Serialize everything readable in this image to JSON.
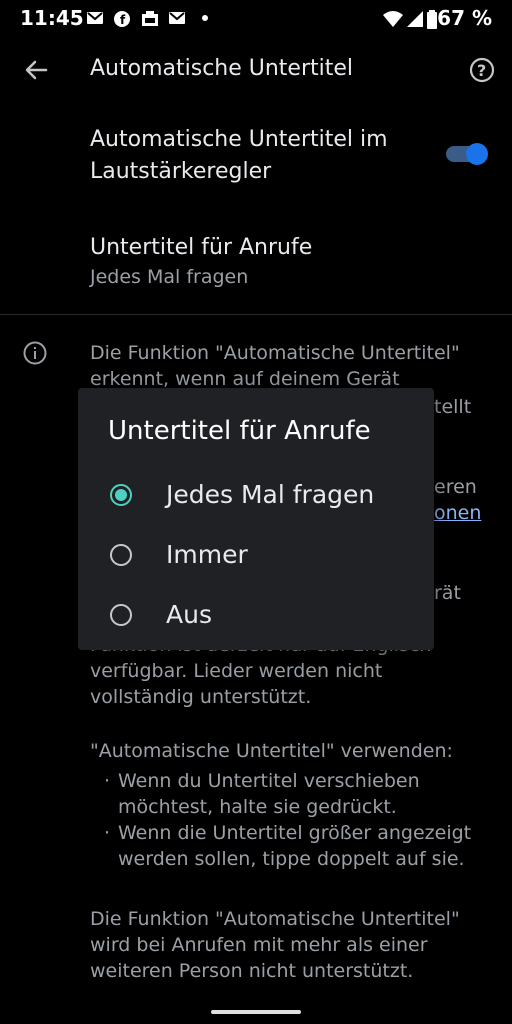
{
  "status_bar": {
    "time": "11:45",
    "icons": [
      "gmail-icon",
      "facebook-icon",
      "app-icon",
      "mail-icon",
      "dot-icon"
    ],
    "battery_percent": "67 %"
  },
  "app_bar": {
    "title": "Automatische Untertitel",
    "back_icon": "arrow-back-icon",
    "help_icon": "help-icon"
  },
  "settings": {
    "item1": {
      "title_line1": "Automatische Untertitel im",
      "title_line2": "Lautstärkeregler",
      "toggle_on": true
    },
    "item2": {
      "title": "Untertitel für Anrufe",
      "subtitle": "Jedes Mal fragen"
    }
  },
  "info": {
    "p1_line1": "Die Funktion \"Automatische Untertitel\"",
    "p1_line2": "erkennt, wenn auf deinem Gerät",
    "p1_line3_fragment": "tellt",
    "p1_line5_fragment": "eren",
    "p1_link_fragment": "onen",
    "p1_line7_fragment": "rät",
    "p2_line1": "Funktion ist derzeit nur auf Englisch",
    "p2_line2": "verfügbar. Lieder werden nicht",
    "p2_line3": "vollständig unterstützt.",
    "p3_heading": "\"Automatische Untertitel\" verwenden:",
    "bullets": [
      {
        "line1": "Wenn du Untertitel verschieben",
        "line2": "möchtest, halte sie gedrückt."
      },
      {
        "line1": "Wenn die Untertitel größer angezeigt",
        "line2": "werden sollen, tippe doppelt auf sie."
      }
    ],
    "p4_line1": "Die Funktion \"Automatische Untertitel\"",
    "p4_line2": "wird bei Anrufen mit mehr als einer",
    "p4_line3": "weiteren Person nicht unterstützt."
  },
  "dialog": {
    "title": "Untertitel für Anrufe",
    "options": [
      {
        "label": "Jedes Mal fragen",
        "selected": true
      },
      {
        "label": "Immer",
        "selected": false
      },
      {
        "label": "Aus",
        "selected": false
      }
    ]
  },
  "colors": {
    "accent": "#4dd0c0",
    "toggle": "#1a73e8",
    "link": "#8ab4f8"
  }
}
